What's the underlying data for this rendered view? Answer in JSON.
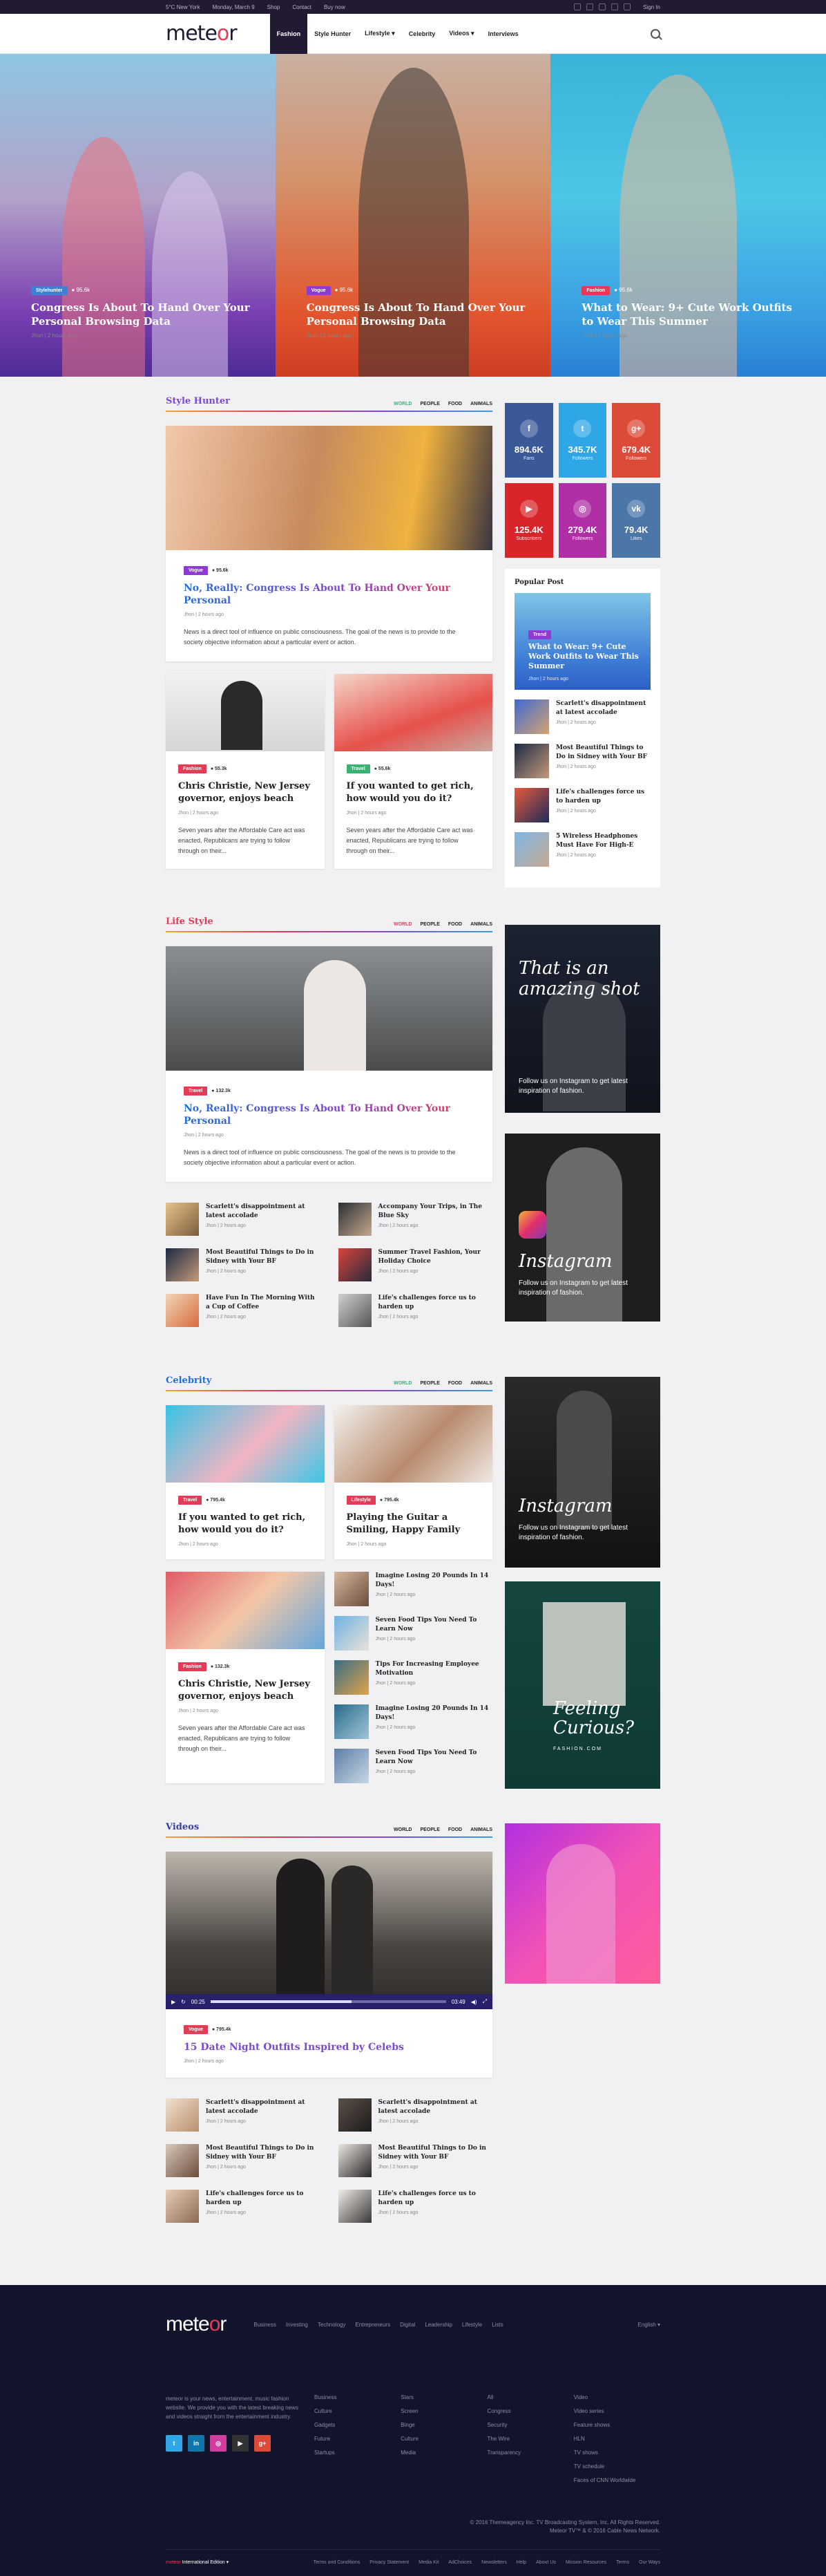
{
  "topbar": {
    "left": [
      "5°C New York",
      "Monday, March 9",
      "Shop",
      "Contact",
      "Buy now"
    ],
    "signin": "Sign In"
  },
  "header": {
    "logo_a": "mete",
    "logo_o": "o",
    "logo_b": "r",
    "nav": [
      "Fashion",
      "Style Hunter",
      "Lifestyle ▾",
      "Celebrity",
      "Videos ▾",
      "Interviews"
    ]
  },
  "hero": [
    {
      "badge": "Stylehunter",
      "badge_color": "#3b82d6",
      "views": "● 95.6k",
      "title": "Congress Is About To Hand Over Your Personal Browsing Data",
      "by": "Jhon  |  2 hours ago"
    },
    {
      "badge": "Vogue",
      "badge_color": "#8d3bd3",
      "views": "● 95.6k",
      "title": "Congress Is About To Hand Over Your Personal Browsing Data",
      "by": "Jhon  |  2 hours ago"
    },
    {
      "badge": "Fashion",
      "badge_color": "#e33c57",
      "views": "● 95.6k",
      "title": "What to Wear: 9+ Cute Work Outfits to Wear This Summer",
      "by": "Jhon  |  2 hours ago"
    }
  ],
  "tabs": [
    "WORLD",
    "PEOPLE",
    "FOOD",
    "ANIMALS"
  ],
  "style_hunter": {
    "title": "Style Hunter",
    "feature": {
      "badge": "Vogue",
      "views": "● 95.6k",
      "title": "No, Really: Congress Is About To Hand Over Your Personal",
      "by": "Jhon  |  2 hours ago",
      "desc": "News is a direct tool of influence on public consciousness. The goal of the news is to provide to the society objective information about a particular event or action."
    },
    "cards": [
      {
        "badge": "Fashion",
        "views": "● 55.3k",
        "title": "Chris Christie, New Jersey governor, enjoys beach",
        "by": "Jhon  |  2 hours ago",
        "desc": "Seven years after the Affordable Care act was enacted, Republicans are trying to follow through on their..."
      },
      {
        "badge": "Travel",
        "views": "● 55.6k",
        "title": "If you wanted to get rich, how would you do it?",
        "by": "Jhon  |  2 hours ago",
        "desc": "Seven years after the Affordable Care act was enacted, Republicans are trying to follow through on their..."
      }
    ]
  },
  "social": [
    {
      "icon": "f",
      "count": "894.6K",
      "label": "Fans",
      "color": "#3b5998"
    },
    {
      "icon": "t",
      "count": "345.7K",
      "label": "Followers",
      "color": "#2fa6e6"
    },
    {
      "icon": "g+",
      "count": "679.4K",
      "label": "Followers",
      "color": "#dc4a38"
    },
    {
      "icon": "▶",
      "count": "125.4K",
      "label": "Subscribers",
      "color": "#d9252a"
    },
    {
      "icon": "◎",
      "count": "279.4K",
      "label": "Followers",
      "color": "#b02fa6"
    },
    {
      "icon": "vk",
      "count": "79.4K",
      "label": "Likes",
      "color": "#4a76a8"
    }
  ],
  "popular": {
    "title": "Popular Post",
    "feature": {
      "badge": "Trend",
      "title": "What to Wear: 9+ Cute Work Outfits to Wear This Summer",
      "by": "Jhon  |  2 hours ago"
    },
    "items": [
      {
        "title": "Scarlett's disappointment at latest accolade",
        "by": "Jhon  |  2 hours ago"
      },
      {
        "title": "Most Beautiful Things to Do in Sidney with Your BF",
        "by": "Jhon  |  2 hours ago"
      },
      {
        "title": "Life's challenges force us to harden up",
        "by": "Jhon  |  2 hours ago"
      },
      {
        "title": "5 Wireless Headphones Must Have For High-E",
        "by": "Jhon  |  2 hours ago"
      }
    ]
  },
  "life_style": {
    "title": "Life Style",
    "feature": {
      "badge": "Travel",
      "views": "● 132.3k",
      "title": "No, Really: Congress Is About To Hand Over Your Personal",
      "by": "Jhon  |  2 hours ago",
      "desc": "News is a direct tool of influence on public consciousness. The goal of the news is to provide to the society objective information about a particular event or action."
    },
    "list": [
      {
        "title": "Scarlett's disappointment at latest accolade",
        "by": "Jhon  |  2 hours ago"
      },
      {
        "title": "Accompany Your Trips, in The Blue Sky",
        "by": "Jhon  |  2 hours ago"
      },
      {
        "title": "Most Beautiful Things to Do in Sidney with Your BF",
        "by": "Jhon  |  2 hours ago"
      },
      {
        "title": "Summer Travel Fashion, Your Holiday Choice",
        "by": "Jhon  |  2 hours ago"
      },
      {
        "title": "Have Fun In The Morning With a Cup of Coffee",
        "by": "Jhon  |  2 hours ago"
      },
      {
        "title": "Life's challenges force us to harden up",
        "by": "Jhon  |  2 hours ago"
      }
    ]
  },
  "promo1": {
    "title": "That is an amazing shot",
    "text": "Follow us on Instagram to get latest inspiration of fashion."
  },
  "promo2": {
    "title": "Instagram",
    "text": "Follow us on Instagram to get latest inspiration of fashion."
  },
  "promo3": {
    "title": "Instagram",
    "text": "Follow us on Instagram to get latest inspiration of fashion."
  },
  "promo4": {
    "title": "Feeling Curious?",
    "sub": "FASHION.COM"
  },
  "celebrity": {
    "title": "Celebrity",
    "cards": [
      {
        "badge": "Travel",
        "views": "● 795.4k",
        "title": "If you wanted to get rich, how would you do it?",
        "by": "Jhon  |  2 hours ago"
      },
      {
        "badge": "Lifestyle",
        "views": "● 795.4k",
        "title": "Playing the Guitar a Smiling, Happy Family",
        "by": "Jhon  |  2 hours ago"
      }
    ],
    "feature": {
      "badge": "Fashion",
      "views": "● 132.3k",
      "title": "Chris Christie, New Jersey governor, enjoys beach",
      "by": "Jhon  |  2 hours ago",
      "desc": "Seven years after the Affordable Care act was enacted, Republicans are trying to follow through on their..."
    },
    "list": [
      {
        "title": "Imagine Losing 20 Pounds In 14 Days!",
        "by": "Jhon  |  2 hours ago"
      },
      {
        "title": "Seven Food Tips You Need To Learn Now",
        "by": "Jhon  |  2 hours ago"
      },
      {
        "title": "Tips For Increasing Employee Motivation",
        "by": "Jhon  |  2 hours ago"
      },
      {
        "title": "Imagine Losing 20 Pounds In 14 Days!",
        "by": "Jhon  |  2 hours ago"
      },
      {
        "title": "Seven Food Tips You Need To Learn Now",
        "by": "Jhon  |  2 hours ago"
      }
    ]
  },
  "videos": {
    "title": "Videos",
    "player": {
      "time": "00:25",
      "duration": "03:49",
      "progress": 0.6
    },
    "feature": {
      "badge": "Vogue",
      "views": "● 795.4k",
      "title": "15 Date Night Outfits Inspired by Celebs",
      "by": "Jhon  |  2 hours ago"
    },
    "list": [
      {
        "title": "Scarlett's disappointment at latest accolade",
        "by": "Jhon  |  2 hours ago"
      },
      {
        "title": "Scarlett's disappointment at latest accolade",
        "by": "Jhon  |  2 hours ago"
      },
      {
        "title": "Most Beautiful Things to Do in Sidney with Your BF",
        "by": "Jhon  |  2 hours ago"
      },
      {
        "title": "Most Beautiful Things to Do in Sidney with Your BF",
        "by": "Jhon  |  2 hours ago"
      },
      {
        "title": "Life's challenges force us to harden up",
        "by": "Jhon  |  2 hours ago"
      },
      {
        "title": "Life's challenges force us to harden up",
        "by": "Jhon  |  2 hours ago"
      }
    ]
  },
  "footer": {
    "nav": [
      "Business",
      "Investing",
      "Technology",
      "Entrepreneurs",
      "Digital",
      "Leadership",
      "Lifestyle",
      "Lists"
    ],
    "lang": "English ▾",
    "about": "meteor is your news, entertainment, music fashion website. We provide you with the latest breaking news and videos straight from the entertainment industry.",
    "cols": [
      [
        "Business",
        "Culture",
        "Gadgets",
        "Future",
        "Startups"
      ],
      [
        "Stars",
        "Screen",
        "Binge",
        "Culture",
        "Media"
      ],
      [
        "All",
        "Congress",
        "Security",
        "The Wire",
        "Transparency"
      ],
      [
        "Video",
        "Video series",
        "Feature shows",
        "HLN",
        "TV shows",
        "TV schedule",
        "Faces of CNN Worldwide"
      ]
    ],
    "social": [
      {
        "icon": "t",
        "color": "#2fa6e6"
      },
      {
        "icon": "in",
        "color": "#0e76a8"
      },
      {
        "icon": "◎",
        "color": "#d13ea0"
      },
      {
        "icon": "▶",
        "color": "#333"
      },
      {
        "icon": "g+",
        "color": "#dc4a38"
      }
    ],
    "copy1": "© 2016 Themeagency Inc. TV Broadcasting System, Inc. All Rights Reserved.",
    "copy2": "Meteor TV™ & © 2016 Cable News Network.",
    "edition": "International Edition ▾",
    "edition_brand": "meteor",
    "links": [
      "Terms and Conditions",
      "Privacy Statement",
      "Media Kit",
      "AdChoices",
      "Newsletters",
      "Help",
      "About Us",
      "Mission Resources",
      "Terms",
      "Our Ways"
    ]
  }
}
